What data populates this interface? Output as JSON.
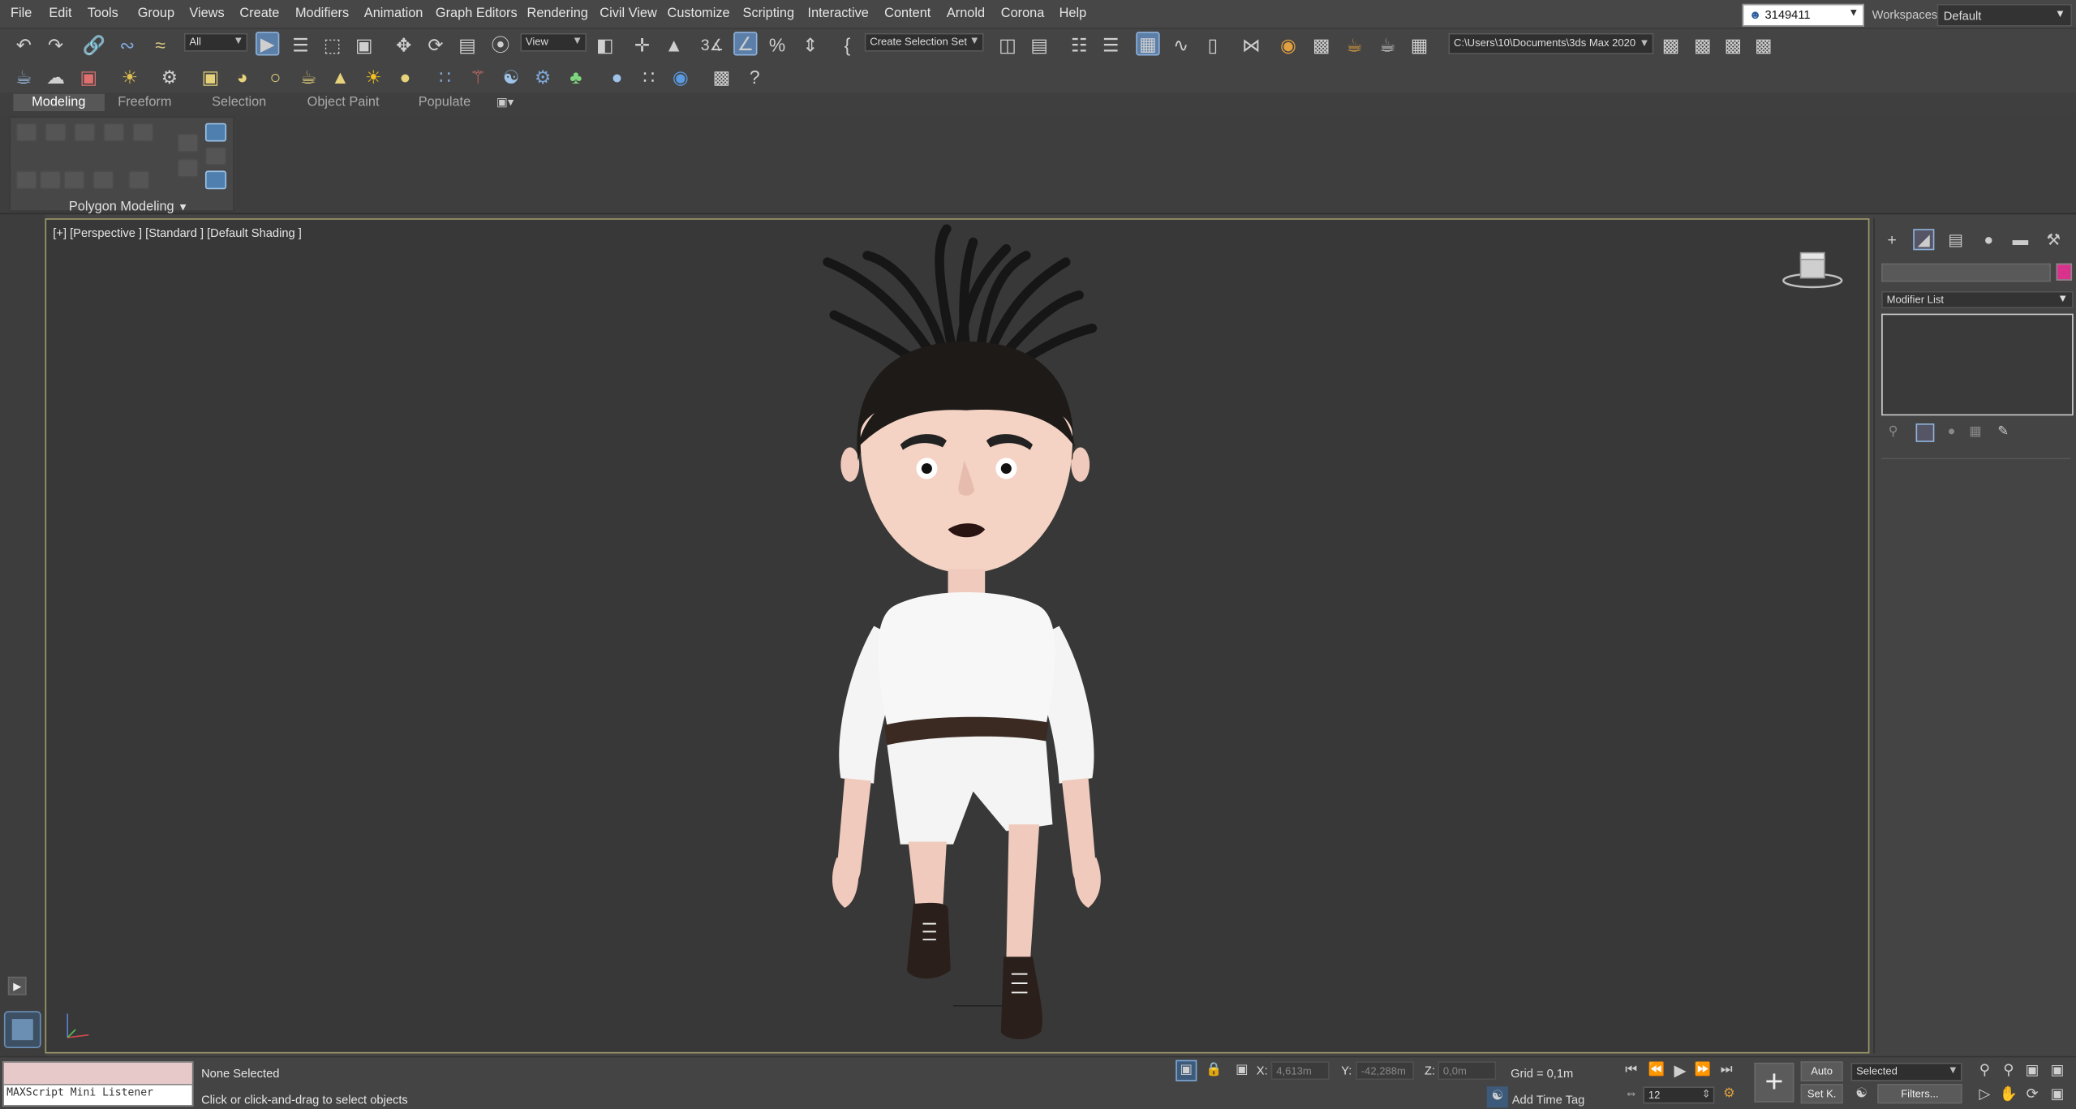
{
  "menu": [
    "File",
    "Edit",
    "Tools",
    "Group",
    "Views",
    "Create",
    "Modifiers",
    "Animation",
    "Graph Editors",
    "Rendering",
    "Civil View",
    "Customize",
    "Scripting",
    "Interactive",
    "Content",
    "Arnold",
    "Corona",
    "Help"
  ],
  "user": {
    "name": "3149411"
  },
  "workspaces": {
    "label": "Workspaces:",
    "value": "Default"
  },
  "toolbar": {
    "selection_filter": "All",
    "ref_coord": "View",
    "selection_set": "Create Selection Set",
    "project_path": "C:\\Users\\10\\Documents\\3ds Max 2020"
  },
  "ribbon": {
    "tabs": [
      "Modeling",
      "Freeform",
      "Selection",
      "Object Paint",
      "Populate"
    ],
    "panel_label": "Polygon Modeling"
  },
  "viewport": {
    "label": "[+] [Perspective ] [Standard ] [Default Shading ]"
  },
  "command_panel": {
    "modifier_list": "Modifier List",
    "object_color": "#d9328c"
  },
  "status": {
    "maxscript": "MAXScript Mini Listener",
    "selection": "None Selected",
    "prompt": "Click or click-and-drag to select objects",
    "x_label": "X:",
    "x_value": "4,613m",
    "y_label": "Y:",
    "y_value": "-42,288m",
    "z_label": "Z:",
    "z_value": "0,0m",
    "grid": "Grid = 0,1m",
    "time_tag": "Add Time Tag",
    "auto_key": "Auto",
    "set_key": "Set K.",
    "key_filter": "Selected",
    "filters": "Filters...",
    "frame": "12"
  },
  "colors": {
    "accent": "#5b7fa8",
    "viewport_border": "#9e9a6b",
    "background": "#444444"
  },
  "icons": [
    "undo-icon",
    "redo-icon",
    "link-icon",
    "unlink-icon",
    "bind-space-warp-icon",
    "select-object-icon",
    "select-by-name-icon",
    "rect-selection-icon",
    "window-crossing-icon",
    "move-icon",
    "rotate-icon",
    "scale-icon",
    "placement-icon",
    "pivot-icon",
    "snap-icon",
    "angle-snap-icon",
    "percent-snap-icon",
    "spinner-snap-icon",
    "mirror-icon",
    "align-icon",
    "layer-explorer-icon",
    "scene-explorer-icon",
    "ribbon-toggle-icon",
    "curve-editor-icon",
    "dope-sheet-icon",
    "schematic-view-icon",
    "material-editor-icon",
    "render-setup-icon",
    "render-frame-icon",
    "render-icon",
    "help-icon",
    "view-cube-icon",
    "create-tab-icon",
    "modify-tab-icon",
    "hierarchy-tab-icon",
    "motion-tab-icon",
    "display-tab-icon",
    "utilities-tab-icon",
    "play-icon",
    "zoom-icon",
    "pan-icon",
    "orbit-icon"
  ]
}
